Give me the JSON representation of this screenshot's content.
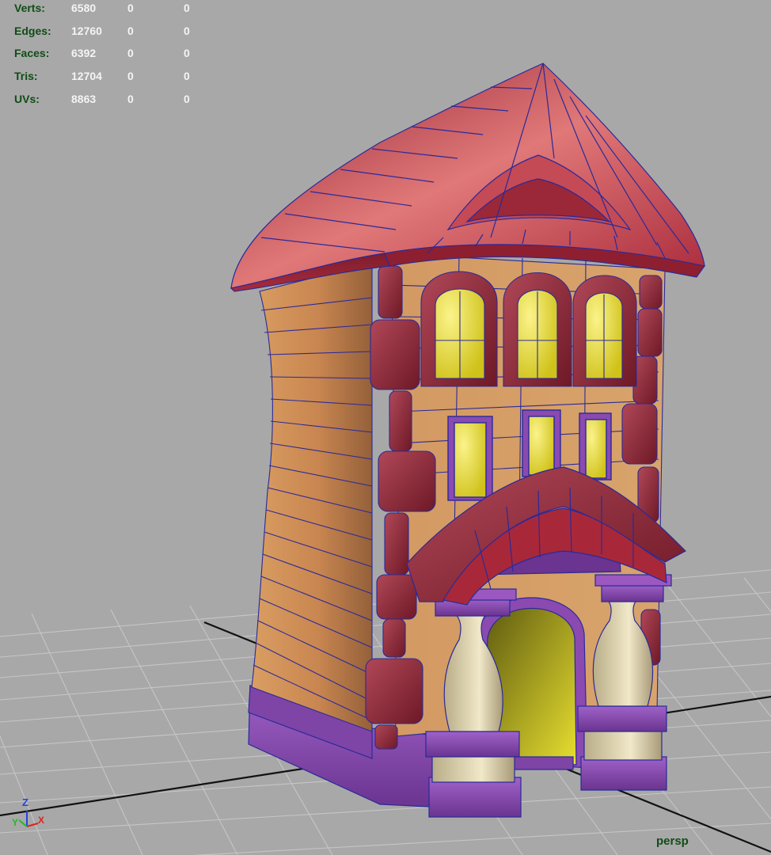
{
  "stats": [
    {
      "label": "Verts:",
      "value": "6580",
      "selected": "0",
      "component": "0"
    },
    {
      "label": "Edges:",
      "value": "12760",
      "selected": "0",
      "component": "0"
    },
    {
      "label": "Faces:",
      "value": "6392",
      "selected": "0",
      "component": "0"
    },
    {
      "label": "Tris:",
      "value": "12704",
      "selected": "0",
      "component": "0"
    },
    {
      "label": "UVs:",
      "value": "8863",
      "selected": "0",
      "component": "0"
    }
  ],
  "camera": {
    "name": "persp"
  },
  "axes": {
    "z": "Z",
    "y": "Y",
    "x": "X"
  },
  "colors": {
    "background": "#a8a8a8",
    "grid": "#c4c4c4",
    "roof": "#a8283a",
    "wall": "#c98650",
    "wireframe": "#2a2a9a",
    "window": "#eedd22",
    "base": "#8a4ab0",
    "pillar": "#e2d9b0",
    "hud_label": "#0f4d16",
    "hud_value": "#f4f4f4"
  },
  "icons": [
    "axis-gizmo-icon"
  ]
}
